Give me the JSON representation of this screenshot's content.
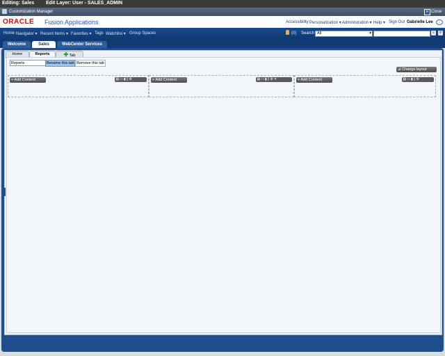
{
  "title_bar": {
    "editing": "Editing: Sales",
    "edit_layer": "Edit Layer: User - SALES_ADMIN"
  },
  "manager_bar": {
    "label": "Customization Manager",
    "close": "Close"
  },
  "brand": {
    "logo": "ORACLE",
    "product": "Fusion Applications",
    "links": [
      "Accessibility",
      "Personalization ▾",
      "Administration ▾",
      "Help ▾",
      "Sign Out"
    ],
    "user": "Gabrielle Lee"
  },
  "nav": {
    "items": [
      "Home",
      "Navigator ▾",
      "Recent Items ▾",
      "Favorites ▾",
      "Tags",
      "Watchlist ▾",
      "Group Spaces"
    ],
    "notif_count": "(0)",
    "search_label": "Search",
    "search_scope": "All"
  },
  "main_tabs": [
    "Welcome",
    "Sales",
    "WebCenter Services"
  ],
  "sub_tabs": {
    "home": "Home",
    "reports": "Reports",
    "add": "Tab"
  },
  "tab_edit": {
    "name_value": "Reports",
    "rename": "Rename this tab",
    "remove": "Remove this tab"
  },
  "change_layout": "Change layout",
  "add_content": "Add Content",
  "colors": {
    "oracle_red": "#e00000",
    "nav_blue": "#0f3a74",
    "highlight": "#9fc4ec"
  }
}
